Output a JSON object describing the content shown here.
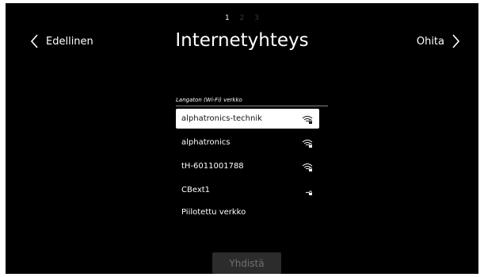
{
  "steps": [
    "1",
    "2",
    "3"
  ],
  "nav": {
    "back_label": "Edellinen",
    "skip_label": "Ohita"
  },
  "title": "Internetyhteys",
  "list_caption": "Langaton (Wi-Fi) verkko",
  "networks": [
    {
      "name": "alphatronics-technik",
      "icon": "wifi-locked-icon",
      "selected": true
    },
    {
      "name": "alphatronics",
      "icon": "wifi-locked-icon",
      "selected": false
    },
    {
      "name": "tH-6011001788",
      "icon": "wifi-locked-icon",
      "selected": false
    },
    {
      "name": "CBext1",
      "icon": "wifi-weak-locked-icon",
      "selected": false
    },
    {
      "name": "Piilotettu verkko",
      "icon": "",
      "selected": false
    }
  ],
  "connect_label": "Yhdistä",
  "colors": {
    "background": "#000000",
    "text": "#ffffff",
    "selected_bg": "#ffffff",
    "button_bg": "#2c2c2c",
    "button_text": "#707070"
  }
}
